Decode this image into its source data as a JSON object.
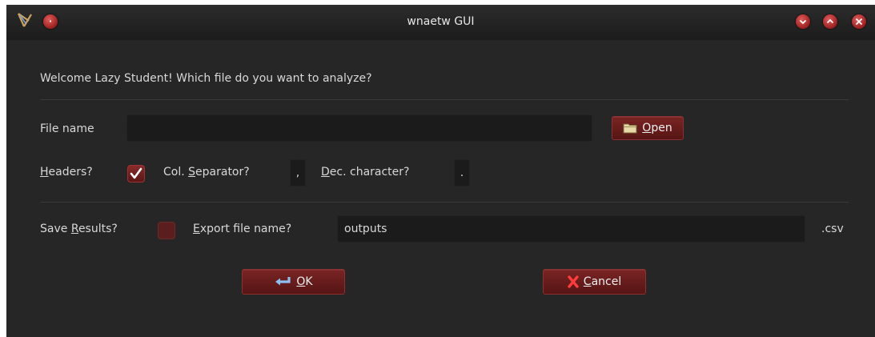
{
  "window": {
    "title": "wnaetw GUI"
  },
  "titlebar": {
    "icons": [
      "app-icon",
      "window-menu-icon",
      "minimize-icon",
      "maximize-icon",
      "close-icon"
    ]
  },
  "form": {
    "welcome": "Welcome Lazy Student! Which file do you want to analyze?",
    "file_name_label": "File name",
    "file_name_value": "",
    "open_button": {
      "label_mnemonic": "O",
      "label_rest": "pen",
      "icon": "folder-icon"
    },
    "headers_label": {
      "mnemonic": "H",
      "rest": "eaders?"
    },
    "headers_checked": true,
    "col_sep_label": {
      "pre": "Col. ",
      "mnemonic": "S",
      "rest": "eparator?"
    },
    "col_sep_value": ",",
    "dec_char_label": {
      "mnemonic": "D",
      "rest": "ec. character?"
    },
    "dec_char_value": ".",
    "save_results_label": {
      "pre": "Save ",
      "mnemonic": "R",
      "rest": "esults?"
    },
    "save_results_checked": false,
    "export_label": {
      "mnemonic": "E",
      "rest": "xport file name?"
    },
    "export_value": "outputs",
    "export_ext": ".csv"
  },
  "actions": {
    "ok": {
      "mnemonic": "O",
      "rest": "K",
      "icon": "return-arrow-icon"
    },
    "cancel": {
      "mnemonic": "C",
      "rest": "ancel",
      "icon": "red-x-icon"
    }
  },
  "colors": {
    "window_bg": "#262626",
    "field_bg": "#1b1b1b",
    "accent": "#7a2424",
    "text": "#d8d8d8"
  }
}
